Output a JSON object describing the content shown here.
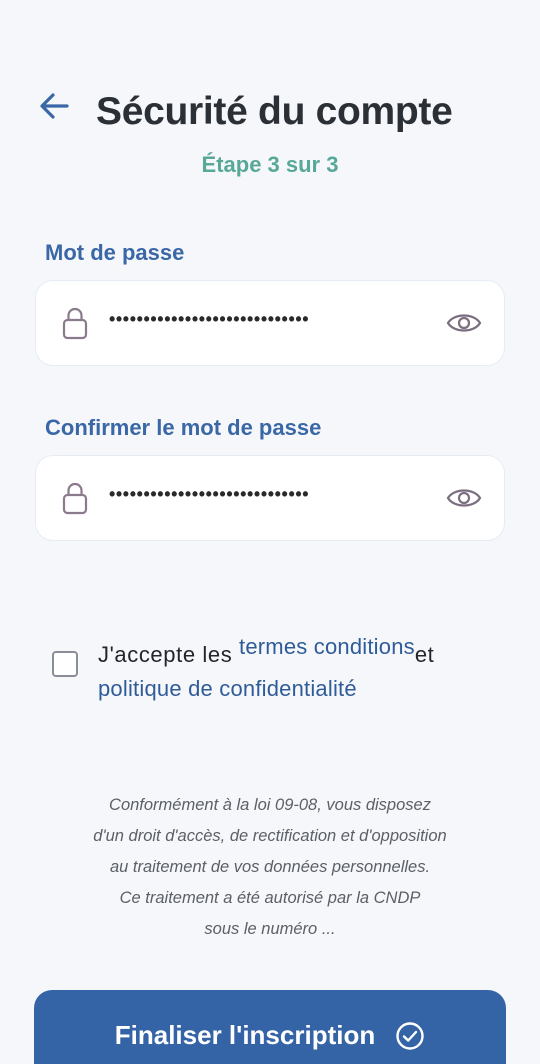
{
  "header": {
    "title": "Sécurité du compte",
    "step": "Étape 3 sur 3",
    "back_icon": "arrow-left-icon"
  },
  "password": {
    "label": "Mot de passe",
    "masked_value": "•••••••••••••••••••••••••••••",
    "lock_icon": "lock-icon",
    "toggle_icon": "eye-icon"
  },
  "confirm_password": {
    "label": "Confirmer le mot de passe",
    "masked_value": "•••••••••••••••••••••••••••••",
    "lock_icon": "lock-icon",
    "toggle_icon": "eye-icon"
  },
  "terms": {
    "checked": false,
    "prefix": "J'accepte les ",
    "terms_link": "termes conditions",
    "conjunction": "et",
    "privacy_link": "politique de confidentialité"
  },
  "legal": {
    "lines": [
      "Conformément à la loi 09-08, vous disposez",
      "d'un droit d'accès, de rectification et d'opposition",
      "au traitement de vos données personnelles.",
      "Ce traitement a été autorisé par la CNDP",
      "sous le numéro ..."
    ]
  },
  "cta": {
    "label": "Finaliser l'inscription",
    "icon": "check-circle-icon"
  },
  "colors": {
    "background": "#f6f7fb",
    "primary": "#3564a6",
    "label_blue": "#3a67a6",
    "step_teal": "#58a898",
    "title": "#2b2f36"
  }
}
